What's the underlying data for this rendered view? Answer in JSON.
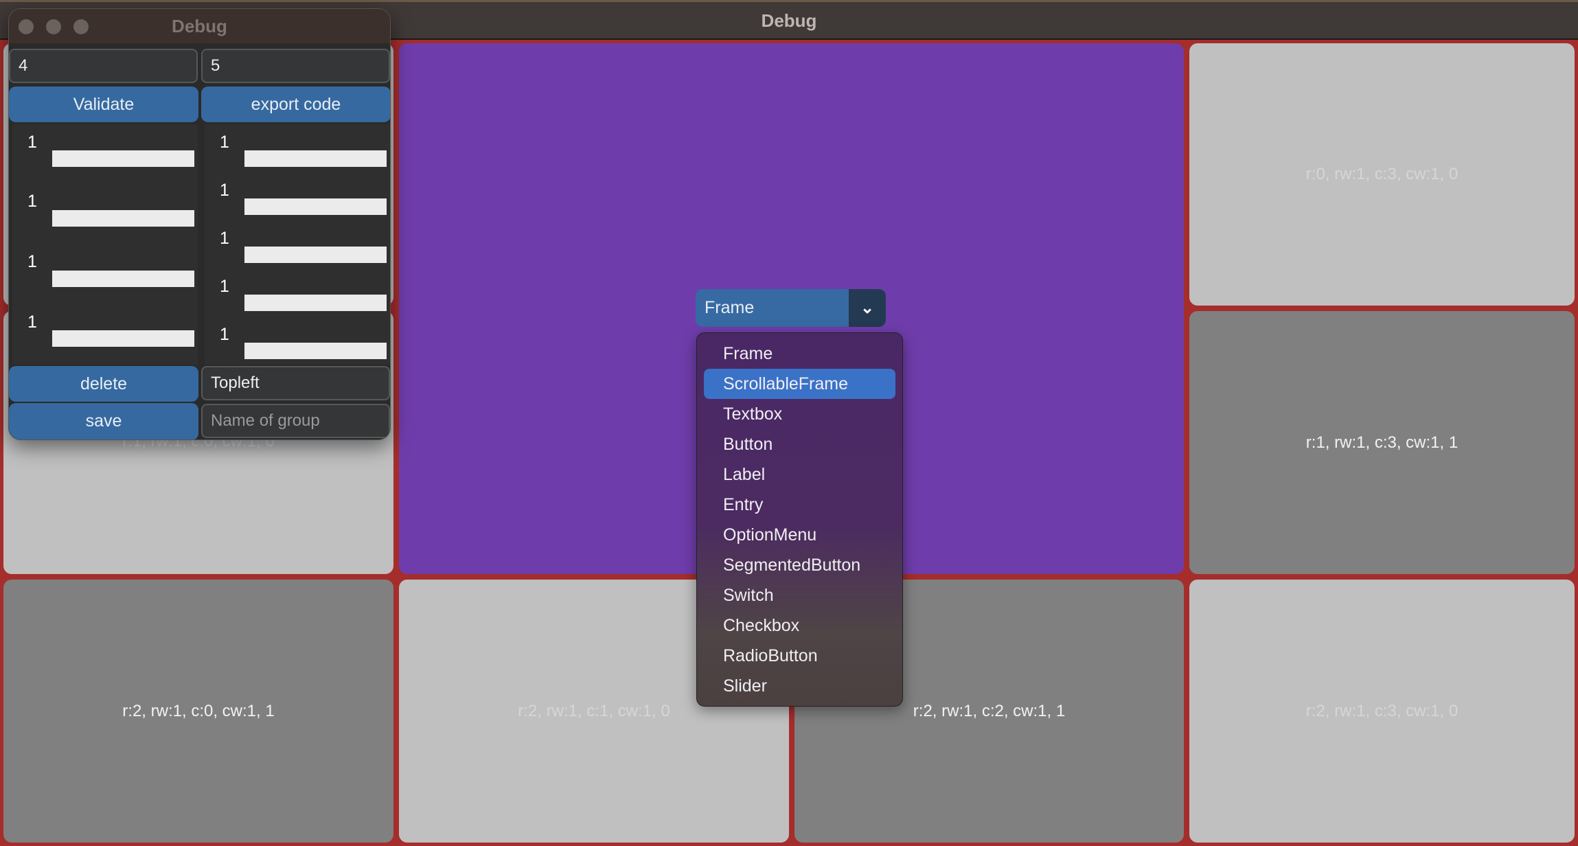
{
  "window": {
    "title": "Debug"
  },
  "grid": {
    "cells": [
      {
        "label": "r:0, rw:1, c:3, cw:1, 0"
      },
      {
        "label": "r:1, rw:1, c:0, cw:1, 0"
      },
      {
        "label": "r:1, rw:1, c:3, cw:1, 1"
      },
      {
        "label": "r:2, rw:1, c:0, cw:1, 1"
      },
      {
        "label": "r:2, rw:1, c:1, cw:1, 0"
      },
      {
        "label": "r:2, rw:1, c:2, cw:1, 1"
      },
      {
        "label": "r:2, rw:1, c:3, cw:1, 0"
      }
    ],
    "colors": {
      "border": "#a52d2b",
      "light": "#c0c0c0",
      "dark": "#808080",
      "selected": "#6f3dab"
    }
  },
  "debug": {
    "title": "Debug",
    "rows_value": "4",
    "cols_value": "5",
    "validate": "Validate",
    "export": "export code",
    "row_weights": [
      "1",
      "1",
      "1",
      "1"
    ],
    "col_weights": [
      "1",
      "1",
      "1",
      "1",
      "1"
    ],
    "delete": "delete",
    "save": "save",
    "anchor_value": "Topleft",
    "group_placeholder": "Name of group"
  },
  "widget_menu": {
    "selected": "Frame",
    "highlighted": "ScrollableFrame",
    "options": [
      "Frame",
      "ScrollableFrame",
      "Textbox",
      "Button",
      "Label",
      "Entry",
      "OptionMenu",
      "SegmentedButton",
      "Switch",
      "Checkbox",
      "RadioButton",
      "Slider"
    ]
  }
}
